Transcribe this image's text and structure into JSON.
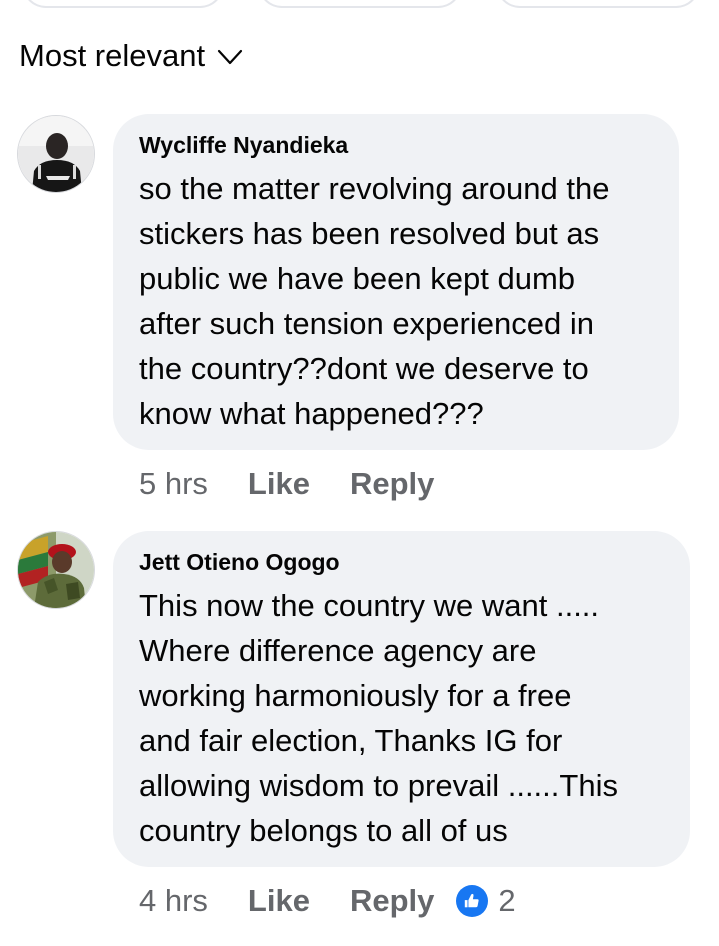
{
  "sort": {
    "label": "Most relevant"
  },
  "comments": [
    {
      "author": "Wycliffe Nyandieka",
      "lines": [
        "so the matter revolving around the",
        "stickers has been resolved but as",
        "public we have been kept dumb",
        "after such tension experienced in",
        "the country??dont we deserve to",
        "know what happened???"
      ],
      "time": "5 hrs",
      "like_label": "Like",
      "reply_label": "Reply"
    },
    {
      "author": "Jett Otieno Ogogo",
      "lines": [
        "This now the country we want .....",
        "Where difference agency are",
        "working harmoniously for a free",
        "and fair election, Thanks IG for",
        "allowing wisdom to prevail ......This",
        "country belongs to all of us"
      ],
      "time": "4 hrs",
      "like_label": "Like",
      "reply_label": "Reply",
      "reaction_count": "2"
    }
  ],
  "colors": {
    "bubble": "#f0f2f5",
    "meta_text": "#65676b",
    "like_badge": "#1877f2"
  }
}
